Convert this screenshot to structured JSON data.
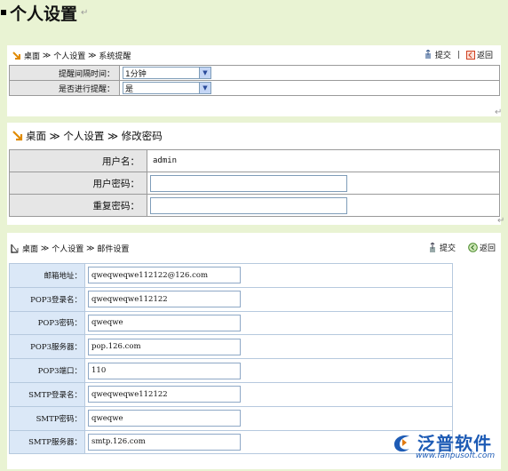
{
  "doc": {
    "title": "个人设置",
    "para_mark": "↵"
  },
  "reminder": {
    "breadcrumb": [
      "桌面",
      "个人设置",
      "系统提醒"
    ],
    "crumb_sep": "≫",
    "submit_label": "提交",
    "back_label": "返回",
    "action_sep": "|",
    "fields": [
      {
        "label": "提醒间隔时间：",
        "value": "1分钟"
      },
      {
        "label": "是否进行提醒：",
        "value": "是"
      }
    ]
  },
  "password": {
    "breadcrumb": [
      "桌面",
      "个人设置",
      "修改密码"
    ],
    "crumb_sep": "≫",
    "fields": [
      {
        "label": "用户名：",
        "value": "admin"
      },
      {
        "label": "用户密码：",
        "value": ""
      },
      {
        "label": "重复密码：",
        "value": ""
      }
    ]
  },
  "mail": {
    "breadcrumb": [
      "桌面",
      "个人设置",
      "邮件设置"
    ],
    "crumb_sep": "≫",
    "submit_label": "提交",
    "back_label": "返回",
    "fields": [
      {
        "label": "邮箱地址：",
        "value": "qweqweqwe112122@126.com"
      },
      {
        "label": "POP3登录名：",
        "value": "qweqweqwe112122"
      },
      {
        "label": "POP3密码：",
        "value": "qweqwe"
      },
      {
        "label": "POP3服务器：",
        "value": "pop.126.com"
      },
      {
        "label": "POP3端口：",
        "value": "110"
      },
      {
        "label": "SMTP登录名：",
        "value": "qweqweqwe112122"
      },
      {
        "label": "SMTP密码：",
        "value": "qweqwe"
      },
      {
        "label": "SMTP服务器：",
        "value": "smtp.126.com"
      }
    ]
  },
  "logo": {
    "name": "泛普软件",
    "url": "www.fanpusoft.com"
  },
  "colors": {
    "page_bg": "#e9f3d3",
    "label_bg": "#e6e6e6",
    "mail_label_bg": "#dbe8f7",
    "crumb_arrow": "#e08a00",
    "brand": "#1d5bb5"
  },
  "icons": {
    "crumb_arrow": "arrow-down-right-icon",
    "submit": "submit-icon",
    "back": "back-icon",
    "select_dropdown": "chevron-down-icon",
    "logo": "fanpu-logo-icon"
  }
}
